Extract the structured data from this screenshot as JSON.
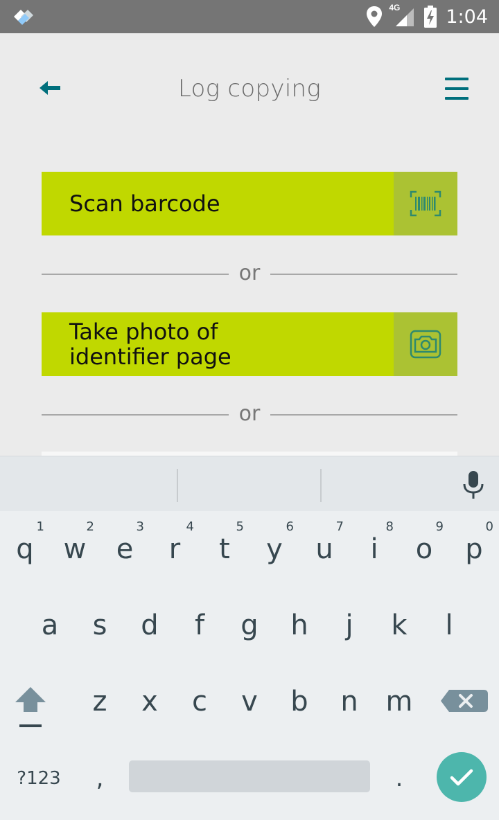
{
  "status_bar": {
    "time": "1:04",
    "network": "4G"
  },
  "header": {
    "title": "Log copying"
  },
  "actions": {
    "scan_label": "Scan barcode",
    "photo_line1": "Take photo of",
    "photo_line2": "identifier page",
    "or_text": "or"
  },
  "colors": {
    "accent": "#c0d800",
    "accent_dark": "#abc233",
    "brand_teal": "#006f7c",
    "enter_key": "#4db6ac"
  },
  "keyboard": {
    "row1": [
      {
        "ch": "q",
        "hint": "1"
      },
      {
        "ch": "w",
        "hint": "2"
      },
      {
        "ch": "e",
        "hint": "3"
      },
      {
        "ch": "r",
        "hint": "4"
      },
      {
        "ch": "t",
        "hint": "5"
      },
      {
        "ch": "y",
        "hint": "6"
      },
      {
        "ch": "u",
        "hint": "7"
      },
      {
        "ch": "i",
        "hint": "8"
      },
      {
        "ch": "o",
        "hint": "9"
      },
      {
        "ch": "p",
        "hint": "0"
      }
    ],
    "row2": [
      "a",
      "s",
      "d",
      "f",
      "g",
      "h",
      "j",
      "k",
      "l"
    ],
    "row3": [
      "z",
      "x",
      "c",
      "v",
      "b",
      "n",
      "m"
    ],
    "symbols_label": "?123",
    "comma": ",",
    "period": "."
  }
}
